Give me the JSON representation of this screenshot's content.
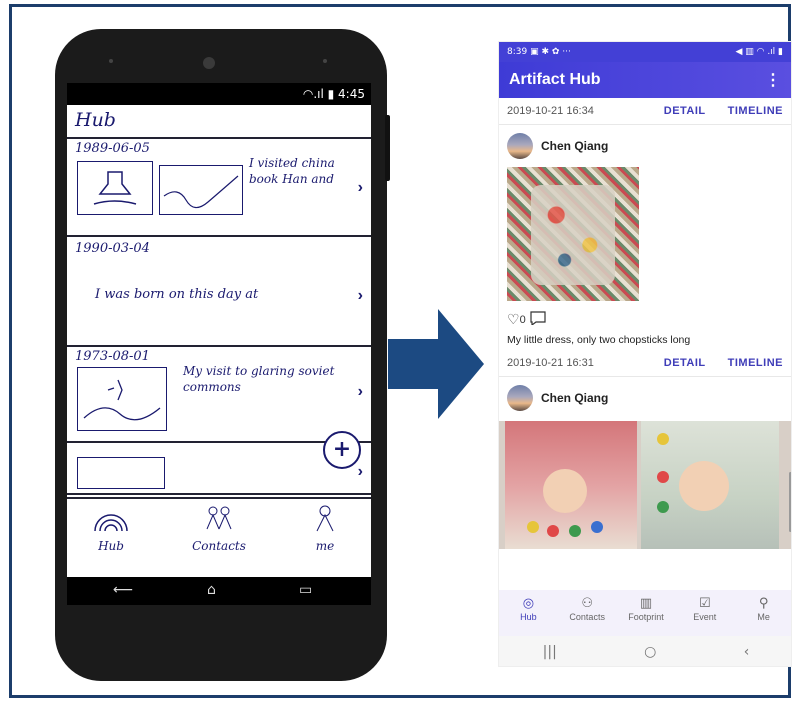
{
  "sketch": {
    "status_time": "4:45",
    "title": "Hub",
    "cards": [
      {
        "date": "1989-06-05",
        "text": "I visited china book Han and"
      },
      {
        "date": "1990-03-04",
        "text": "I was born on this day at"
      },
      {
        "date": "1973-08-01",
        "text": "My visit to glaring soviet commons"
      }
    ],
    "fab": "+",
    "nav": [
      {
        "label": "Hub",
        "icon": "rainbow-icon"
      },
      {
        "label": "Contacts",
        "icon": "people-icon"
      },
      {
        "label": "me",
        "icon": "person-icon"
      }
    ],
    "chevron": "›"
  },
  "app": {
    "status_time": "8:39",
    "status_icons_left": "▣ ✱ ✿ ···",
    "status_icons_right": "◀ ▥ ◠ .ıl ▮",
    "title": "Artifact Hub",
    "menu": "⋮",
    "posts": [
      {
        "date": "2019-10-21 16:34",
        "detail": "DETAIL",
        "timeline": "TIMELINE",
        "user": "Chen Qiang",
        "likes": "0",
        "caption": "My little dress, only two chopsticks long"
      },
      {
        "date": "2019-10-21 16:31",
        "detail": "DETAIL",
        "timeline": "TIMELINE",
        "user": "Chen Qiang"
      }
    ],
    "nav": [
      {
        "label": "Hub",
        "icon": "hub-icon",
        "glyph": "◎"
      },
      {
        "label": "Contacts",
        "icon": "contacts-icon",
        "glyph": "⚇"
      },
      {
        "label": "Footprint",
        "icon": "map-icon",
        "glyph": "▥"
      },
      {
        "label": "Event",
        "icon": "calendar-icon",
        "glyph": "☑"
      },
      {
        "label": "Me",
        "icon": "person-icon",
        "glyph": "⚲"
      }
    ],
    "sys": [
      "|||",
      "○",
      "‹"
    ],
    "accent": "#3f3db8"
  }
}
